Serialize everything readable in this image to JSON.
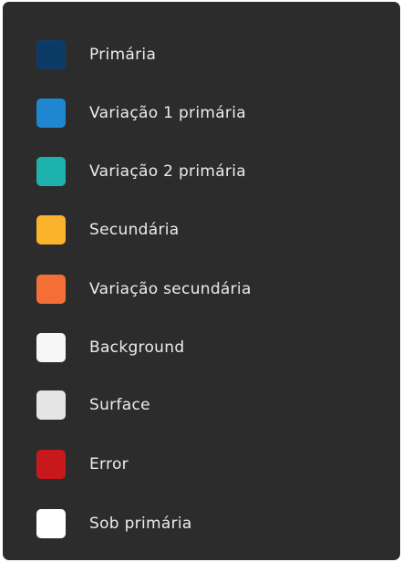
{
  "color_menu": {
    "items": [
      {
        "label": "Primária",
        "color": "#0b3a66"
      },
      {
        "label": "Variação 1 primária",
        "color": "#1f87d0"
      },
      {
        "label": "Variação 2 primária",
        "color": "#1eb2ad"
      },
      {
        "label": "Secundária",
        "color": "#fbb32e"
      },
      {
        "label": "Variação secundária",
        "color": "#f36f35"
      },
      {
        "label": "Background",
        "color": "#f7f7f7"
      },
      {
        "label": "Surface",
        "color": "#e5e5e5"
      },
      {
        "label": "Error",
        "color": "#c8181b"
      },
      {
        "label": "Sob primária",
        "color": "#ffffff"
      }
    ]
  }
}
